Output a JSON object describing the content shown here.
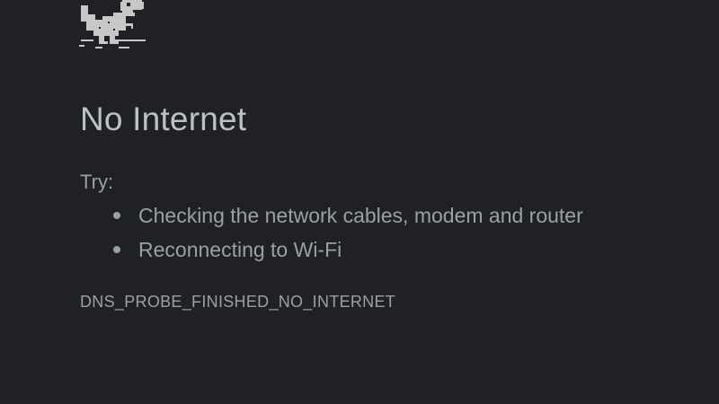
{
  "illustration": {
    "icon": "dinosaur-icon"
  },
  "error": {
    "title": "No Internet",
    "try_label": "Try:",
    "suggestions": [
      "Checking the network cables, modem and router",
      "Reconnecting to Wi-Fi"
    ],
    "code": "DNS_PROBE_FINISHED_NO_INTERNET"
  },
  "colors": {
    "background": "#202124",
    "title": "#bdc1c6",
    "text": "#9aa0a6"
  }
}
